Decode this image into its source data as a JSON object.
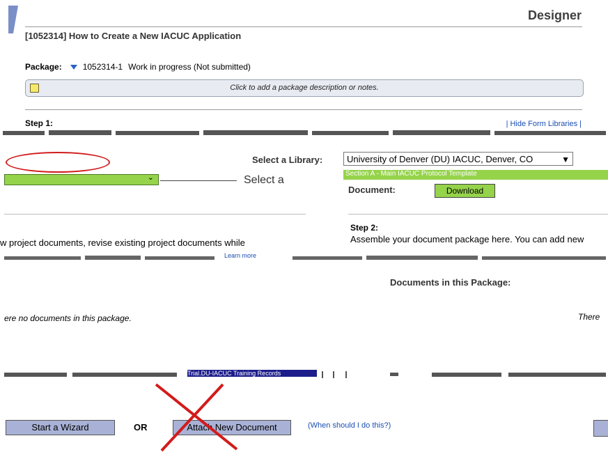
{
  "header": {
    "designer": "Designer"
  },
  "project": {
    "title": "[1052314] How to Create a New IACUC Application"
  },
  "package": {
    "label": "Package:",
    "id": "1052314-1",
    "status": "Work in progress (Not submitted)"
  },
  "notes": {
    "placeholder": "Click to add a package description or notes."
  },
  "step1": {
    "label": "Step 1:",
    "hide_link": "| Hide Form Libraries |"
  },
  "library": {
    "label": "Select a Library:",
    "selected": "University of Denver (DU) IACUC, Denver, CO",
    "section_selected": "Section A - Main IACUC Protocol Template",
    "select_text": "Select a",
    "document_label": "Document:",
    "download_label": "Download"
  },
  "step2": {
    "label": "Step 2:",
    "text": "Assemble your document package here. You can add new"
  },
  "project_docs": {
    "text": "w project documents, revise existing project documents while",
    "learn_more": "Learn more"
  },
  "docs_in_package": {
    "heading": "Documents in this Package:",
    "empty_left": "ere no documents in this package.",
    "empty_right": "There"
  },
  "training": {
    "link": "Trial.DU-IACUC Training Records"
  },
  "actions": {
    "wizard": "Start a Wizard",
    "or": "OR",
    "attach": "Attach New Document",
    "when": "(When should I do this?)"
  },
  "colors": {
    "accent_green": "#95d34a",
    "button": "#a9b2d6",
    "annotation_red": "#d21b1b"
  }
}
